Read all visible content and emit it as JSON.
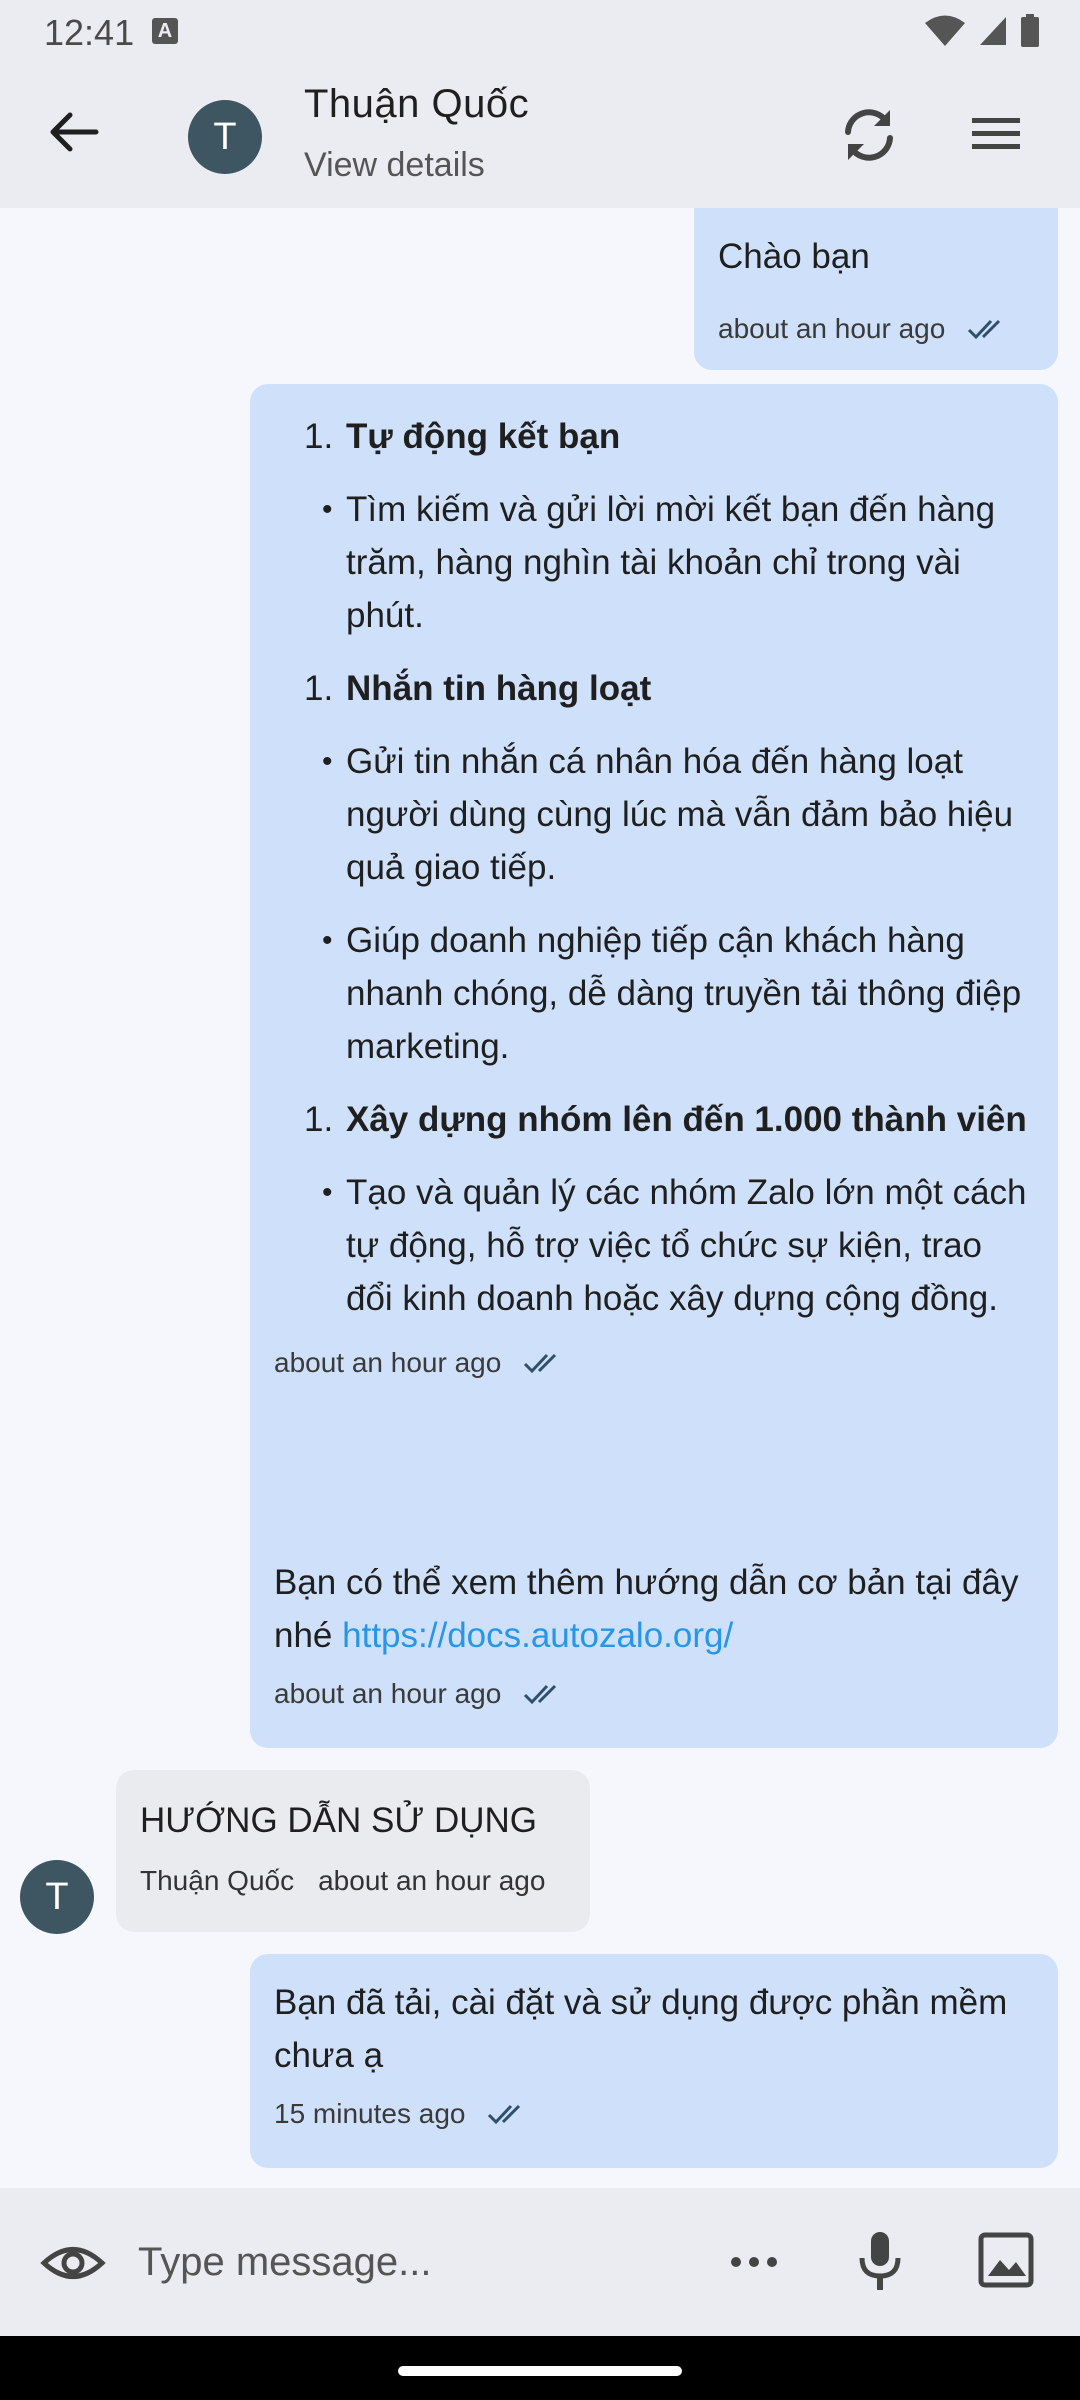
{
  "status_bar": {
    "time": "12:41",
    "badge": "A"
  },
  "header": {
    "contact_name": "Thuận Quốc",
    "subtitle": "View details",
    "avatar_initial": "T"
  },
  "messages": [
    {
      "text": "Chào bạn",
      "time": "about an hour ago"
    },
    {
      "items": [
        {
          "marker": "1.",
          "text": "Tự động kết bạn",
          "bold": true
        },
        {
          "marker": "•",
          "text": "Tìm kiếm và gửi lời mời kết bạn đến hàng trăm, hàng nghìn tài khoản chỉ trong vài phút."
        },
        {
          "marker": "1.",
          "text": "Nhắn tin hàng loạt",
          "bold": true
        },
        {
          "marker": "•",
          "text": "Gửi tin nhắn cá nhân hóa đến hàng loạt người dùng cùng lúc mà vẫn đảm bảo hiệu quả giao tiếp."
        },
        {
          "marker": "•",
          "text": "Giúp doanh nghiệp tiếp cận khách hàng nhanh chóng, dễ dàng truyền tải thông điệp marketing."
        },
        {
          "marker": "1.",
          "text": "Xây dựng nhóm lên đến 1.000 thành viên",
          "bold": true
        },
        {
          "marker": "•",
          "text": "Tạo và quản lý các nhóm Zalo lớn một cách tự động, hỗ trợ việc tổ chức sự kiện, trao đổi kinh doanh hoặc xây dựng cộng đồng."
        }
      ],
      "time": "about an hour ago"
    },
    {
      "text": "Bạn có thể xem thêm hướng dẫn cơ bản tại đây nhé",
      "link": "https://docs.autozalo.org/",
      "time": "about an hour ago"
    },
    {
      "text": "HƯỚNG DẪN SỬ DỤNG",
      "sender": "Thuận Quốc",
      "time": "about an hour ago",
      "avatar_initial": "T"
    },
    {
      "text": "Bạn đã tải, cài đặt và sử dụng được phần mềm chưa ạ",
      "time": "15 minutes ago"
    }
  ],
  "composer": {
    "placeholder": "Type message..."
  },
  "icons": {
    "back": "arrow-left-icon",
    "sync": "sync-icon",
    "menu": "hamburger-menu-icon",
    "read": "double-check-icon",
    "eye": "eye-icon",
    "more": "more-horizontal-icon",
    "mic": "microphone-icon",
    "image": "image-icon"
  },
  "colors": {
    "outgoing_bubble": "#cfe0fa",
    "incoming_bubble": "#e9ebef",
    "link": "#2796e6",
    "avatar": "#3e5562",
    "bar": "#ebecf2"
  }
}
